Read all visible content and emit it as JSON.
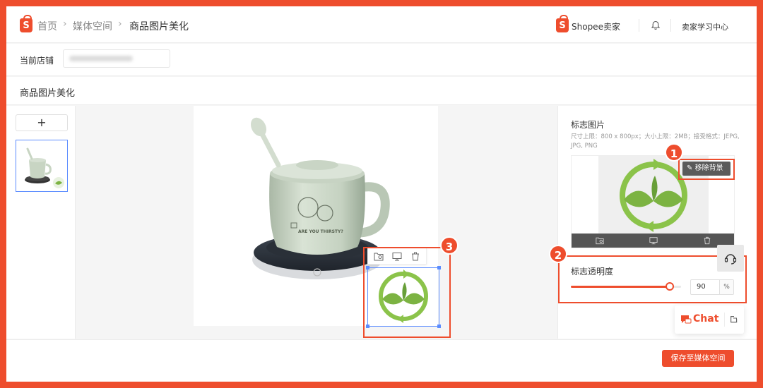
{
  "header": {
    "breadcrumb": [
      "首页",
      "媒体空间",
      "商品图片美化"
    ],
    "brand": "Shopee卖家",
    "learning_center": "卖家学习中心"
  },
  "shop": {
    "label": "当前店铺"
  },
  "section": {
    "title": "商品图片美化"
  },
  "left": {
    "add_label": "+"
  },
  "canvas": {
    "product_text": "ARE YOU THIRSTY?"
  },
  "right": {
    "logo_title": "标志图片",
    "logo_desc": "尺寸上限：800 x 800px；大小上限：2MB；接受格式：JEPG, JPG, PNG",
    "remove_bg_label": "移除背景",
    "opacity_label": "标志透明度",
    "opacity_value": "90",
    "opacity_unit": "%",
    "opacity_fraction": 0.9
  },
  "callouts": [
    "1",
    "2",
    "3"
  ],
  "chat": {
    "label": "Chat"
  },
  "footer": {
    "save_label": "保存至媒体空间"
  },
  "colors": {
    "accent": "#ee4d2d",
    "selection": "#5b8cff",
    "logo_green": "#7cb342"
  },
  "icons": [
    "shopee-logo-icon",
    "chevron-right-icon",
    "bell-icon",
    "folder-image-icon",
    "monitor-icon",
    "trash-icon",
    "brush-icon",
    "headset-icon",
    "chat-icon",
    "expand-icon"
  ]
}
